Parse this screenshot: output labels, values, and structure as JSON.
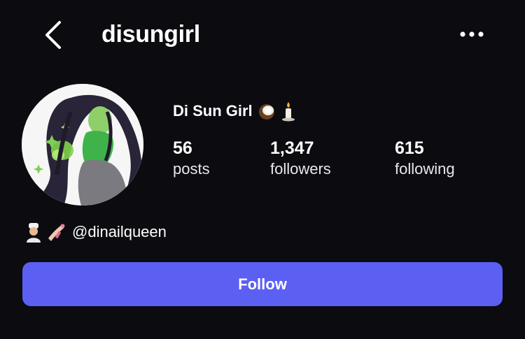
{
  "header": {
    "username": "disungirl",
    "back_icon": "chevron-left-icon",
    "more_icon": "more-horizontal-icon"
  },
  "profile": {
    "display_name": "Di Sun Girl",
    "name_emojis": [
      "coconut-icon",
      "candle-icon"
    ],
    "avatar": "cartoon-character-avatar",
    "stats": [
      {
        "count": "56",
        "label": "posts"
      },
      {
        "count": "1,347",
        "label": "followers"
      },
      {
        "count": "615",
        "label": "following"
      }
    ],
    "bio": {
      "emojis": [
        "cook-person-icon",
        "nail-polish-icon"
      ],
      "mention": "@dinailqueen"
    }
  },
  "actions": {
    "follow_label": "Follow"
  },
  "colors": {
    "background": "#0c0c10",
    "text": "#ffffff",
    "follow_button": "#5b5ff2"
  }
}
